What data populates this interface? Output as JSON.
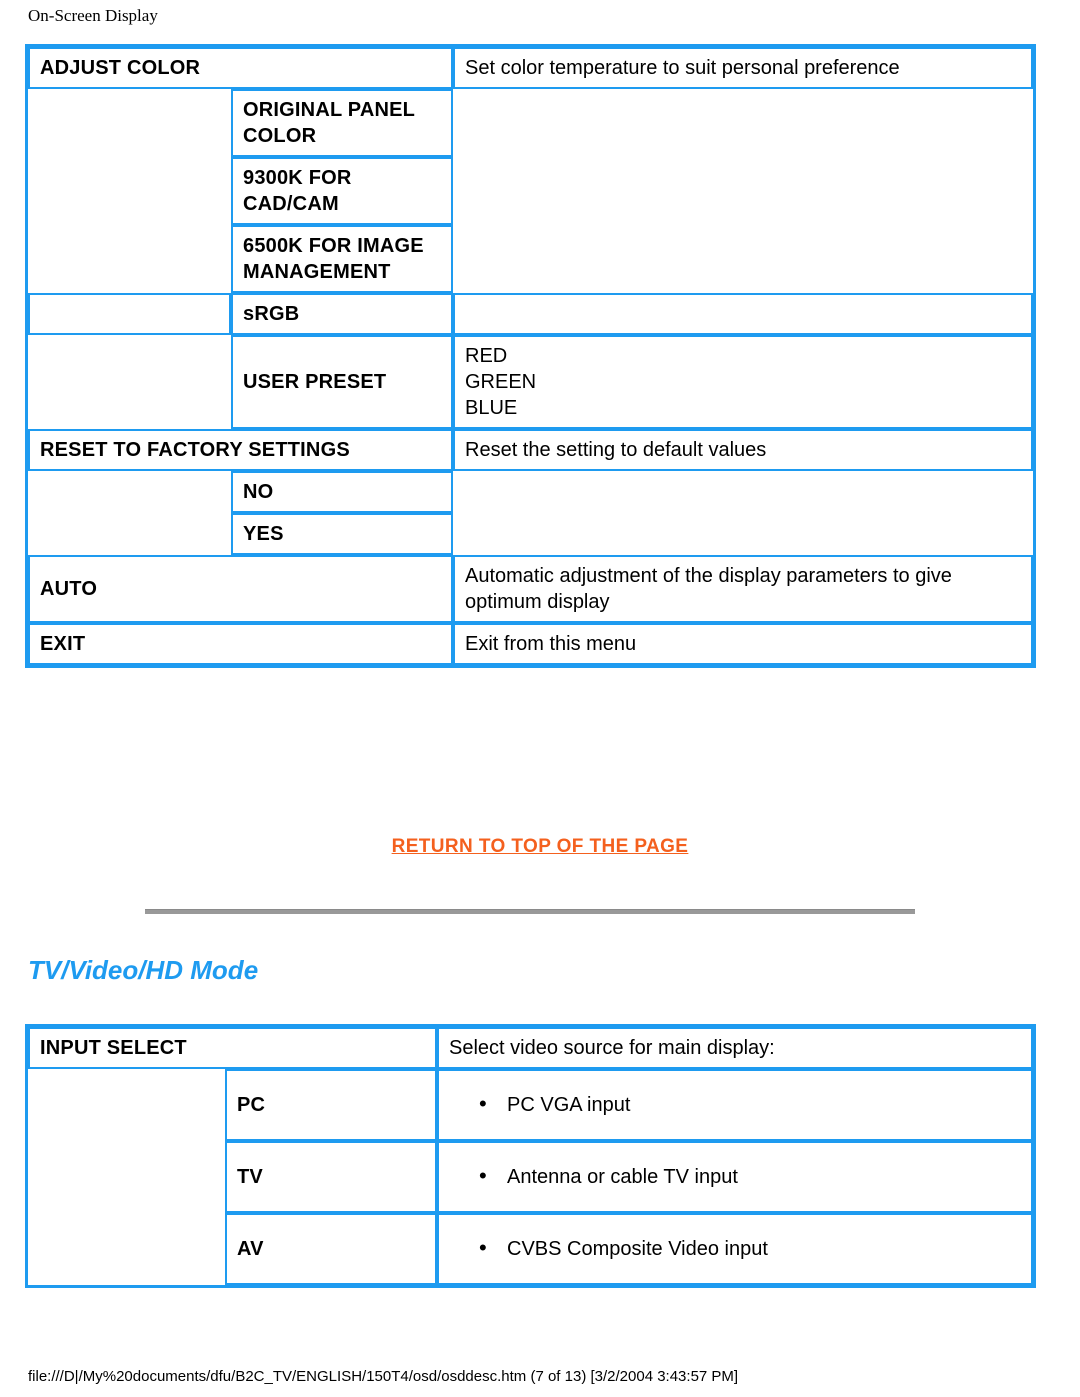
{
  "page": {
    "header": "On-Screen Display",
    "footer_path": "file:///D|/My%20documents/dfu/B2C_TV/ENGLISH/150T4/osd/osddesc.htm (7 of 13) [3/2/2004 3:43:57 PM]",
    "return_link": "RETURN TO TOP OF THE PAGE",
    "section_heading": "TV/Video/HD Mode"
  },
  "colors": {
    "table_border": "#1E9BF0",
    "heading_blue": "#1E9BF0",
    "link_orange": "#F4601E",
    "divider_gray": "#999999",
    "text_black": "#000000"
  },
  "table_adjust_color": {
    "rows": [
      {
        "col1": "ADJUST COLOR",
        "col2": "",
        "col3": "Set color temperature to suit personal preference"
      },
      {
        "col1": "",
        "col2": "ORIGINAL PANEL COLOR",
        "col3": ""
      },
      {
        "col1": "",
        "col2": "9300K FOR CAD/CAM",
        "col3": ""
      },
      {
        "col1": "",
        "col2": "6500K FOR IMAGE MANAGEMENT",
        "col3": ""
      },
      {
        "col1": "",
        "col2": "sRGB",
        "col3": ""
      },
      {
        "col1": "",
        "col2": "USER PRESET",
        "col3": "RED\nGREEN\nBLUE"
      },
      {
        "col1": "RESET TO FACTORY SETTINGS",
        "col2": "",
        "col3": "Reset the setting to default values"
      },
      {
        "col1": "",
        "col2": "NO",
        "col3": ""
      },
      {
        "col1": "",
        "col2": "YES",
        "col3": ""
      },
      {
        "col1": "AUTO",
        "col2": "",
        "col3": "Automatic adjustment of the display parameters to give optimum display"
      },
      {
        "col1": "EXIT",
        "col2": "",
        "col3": "Exit from this menu"
      }
    ]
  },
  "table_input_select": {
    "rows": [
      {
        "col1": "INPUT SELECT",
        "col2": "",
        "col3": "Select video source for main display:"
      },
      {
        "col1": "",
        "col2": "PC",
        "col3": "PC VGA input"
      },
      {
        "col1": "",
        "col2": "TV",
        "col3": "Antenna or cable TV input"
      },
      {
        "col1": "",
        "col2": "AV",
        "col3": "CVBS Composite Video input"
      }
    ]
  }
}
